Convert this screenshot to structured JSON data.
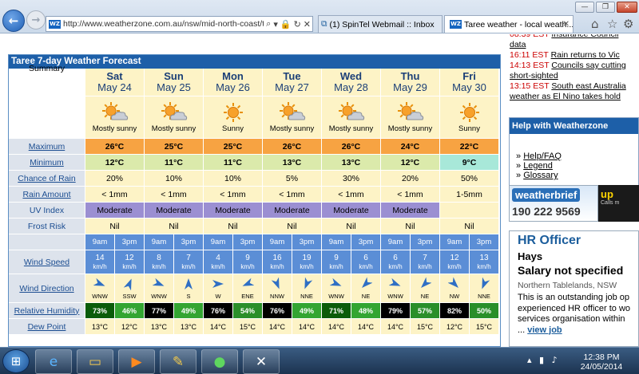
{
  "browser": {
    "address": "http://www.weatherzone.com.au/nsw/mid-north-coast/taree",
    "tabs": [
      {
        "label": "(1) SpinTel Webmail :: Inbox"
      },
      {
        "label": "Taree weather - local weath..."
      }
    ]
  },
  "news": [
    {
      "time": "08:39 EST",
      "text": "Insurance Council",
      "cont": "data"
    },
    {
      "time": "16:11 EST",
      "text": "Rain returns to Vic",
      "cont": ""
    },
    {
      "time": "14:13 EST",
      "text": "Councils say cutting",
      "cont": "short-sighted"
    },
    {
      "time": "13:15 EST",
      "text": "South east Australia",
      "cont": "weather as El Nino takes hold"
    }
  ],
  "help": {
    "title": "Help with Weatherzone",
    "links": [
      "Help/FAQ",
      "Legend",
      "Glossary"
    ]
  },
  "weatherbrief": {
    "logo": "weatherbrief",
    "phone": "190 222 9569",
    "side": "up",
    "side_small": "Calls m"
  },
  "job": {
    "title": "HR Officer",
    "location": "Hays",
    "salary": "Salary not specified",
    "region": "Northern Tablelands, NSW",
    "desc": [
      "This is an outstanding job op",
      "experienced HR officer to wo",
      "services organisation within"
    ],
    "more": "...",
    "link": "view job"
  },
  "forecast": {
    "title": "Taree 7-day Weather Forecast",
    "labels": {
      "summary": "Summary",
      "max": "Maximum",
      "min": "Minimum",
      "rain_chance": "Chance of Rain",
      "rain_amount": "Rain Amount",
      "uv": "UV Index",
      "frost": "Frost Risk",
      "wind_speed": "Wind Speed",
      "wind_dir": "Wind Direction",
      "humidity": "Relative Humidity",
      "dew": "Dew Point"
    },
    "days": [
      {
        "day": "Sat",
        "date": "May 24",
        "summary": "Mostly sunny",
        "icon": "mostly-sunny",
        "max": "26°C",
        "min": "12°C",
        "rain": "20%",
        "amount": "< 1mm",
        "uv": "Moderate",
        "frost": "Nil"
      },
      {
        "day": "Sun",
        "date": "May 25",
        "summary": "Mostly sunny",
        "icon": "mostly-sunny",
        "max": "25°C",
        "min": "11°C",
        "rain": "10%",
        "amount": "< 1mm",
        "uv": "Moderate",
        "frost": "Nil"
      },
      {
        "day": "Mon",
        "date": "May 26",
        "summary": "Sunny",
        "icon": "sunny",
        "max": "25°C",
        "min": "11°C",
        "rain": "10%",
        "amount": "< 1mm",
        "uv": "Moderate",
        "frost": "Nil"
      },
      {
        "day": "Tue",
        "date": "May 27",
        "summary": "Mostly sunny",
        "icon": "mostly-sunny",
        "max": "26°C",
        "min": "13°C",
        "rain": "5%",
        "amount": "< 1mm",
        "uv": "Moderate",
        "frost": "Nil"
      },
      {
        "day": "Wed",
        "date": "May 28",
        "summary": "Mostly sunny",
        "icon": "mostly-sunny",
        "max": "26°C",
        "min": "13°C",
        "rain": "30%",
        "amount": "< 1mm",
        "uv": "Moderate",
        "frost": "Nil"
      },
      {
        "day": "Thu",
        "date": "May 29",
        "summary": "Mostly sunny",
        "icon": "mostly-sunny",
        "max": "24°C",
        "min": "12°C",
        "rain": "20%",
        "amount": "< 1mm",
        "uv": "Moderate",
        "frost": "Nil"
      },
      {
        "day": "Fri",
        "date": "May 30",
        "summary": "Sunny",
        "icon": "sunny",
        "max": "22°C",
        "min": "9°C",
        "rain": "50%",
        "amount": "1-5mm",
        "uv": "",
        "frost": "Nil"
      }
    ],
    "slots": [
      {
        "time": "9am",
        "speed": "14",
        "dir": "WNW",
        "deg": 112,
        "hum": "73%",
        "hum_color": "#0a5c0a",
        "dew": "13°C"
      },
      {
        "time": "3pm",
        "speed": "12",
        "dir": "SSW",
        "deg": 22,
        "hum": "46%",
        "hum_color": "#33a532",
        "dew": "12°C"
      },
      {
        "time": "9am",
        "speed": "8",
        "dir": "WNW",
        "deg": 112,
        "hum": "77%",
        "hum_color": "#000000",
        "dew": "13°C"
      },
      {
        "time": "3pm",
        "speed": "7",
        "dir": "S",
        "deg": 0,
        "hum": "49%",
        "hum_color": "#33a532",
        "dew": "13°C"
      },
      {
        "time": "9am",
        "speed": "4",
        "dir": "W",
        "deg": 90,
        "hum": "76%",
        "hum_color": "#000000",
        "dew": "14°C"
      },
      {
        "time": "3pm",
        "speed": "9",
        "dir": "ENE",
        "deg": 247,
        "hum": "54%",
        "hum_color": "#2a8f2a",
        "dew": "15°C"
      },
      {
        "time": "9am",
        "speed": "16",
        "dir": "NNW",
        "deg": 158,
        "hum": "76%",
        "hum_color": "#000000",
        "dew": "14°C"
      },
      {
        "time": "3pm",
        "speed": "19",
        "dir": "NNE",
        "deg": 202,
        "hum": "49%",
        "hum_color": "#33a532",
        "dew": "14°C"
      },
      {
        "time": "9am",
        "speed": "9",
        "dir": "WNW",
        "deg": 112,
        "hum": "71%",
        "hum_color": "#0a5c0a",
        "dew": "14°C"
      },
      {
        "time": "3pm",
        "speed": "6",
        "dir": "NE",
        "deg": 225,
        "hum": "48%",
        "hum_color": "#33a532",
        "dew": "14°C"
      },
      {
        "time": "9am",
        "speed": "6",
        "dir": "WNW",
        "deg": 112,
        "hum": "79%",
        "hum_color": "#000000",
        "dew": "14°C"
      },
      {
        "time": "3pm",
        "speed": "7",
        "dir": "NE",
        "deg": 225,
        "hum": "57%",
        "hum_color": "#2a8f2a",
        "dew": "15°C"
      },
      {
        "time": "9am",
        "speed": "12",
        "dir": "NW",
        "deg": 135,
        "hum": "82%",
        "hum_color": "#000000",
        "dew": "12°C"
      },
      {
        "time": "3pm",
        "speed": "13",
        "dir": "NNE",
        "deg": 202,
        "hum": "50%",
        "hum_color": "#2a8f2a",
        "dew": "15°C"
      }
    ],
    "speed_unit": "km/h"
  },
  "taskbar": {
    "time": "12:38 PM",
    "date": "24/05/2014"
  }
}
